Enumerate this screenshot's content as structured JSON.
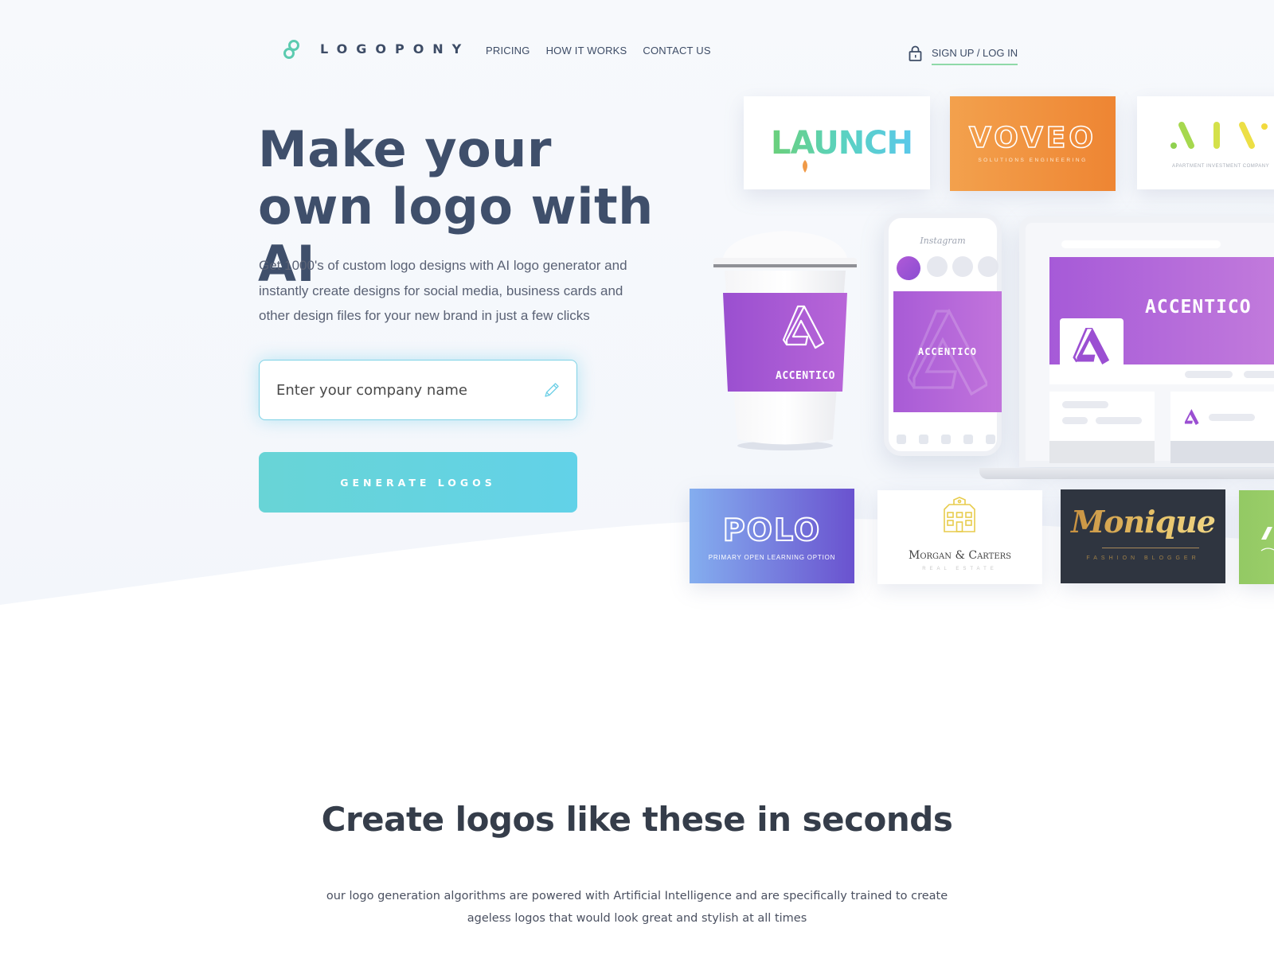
{
  "brand": {
    "name": "LOGOPONY",
    "accent_color": "#5ccbb0"
  },
  "nav": {
    "links": [
      {
        "label": "PRICING"
      },
      {
        "label": "HOW IT WORKS"
      },
      {
        "label": "CONTACT US"
      }
    ],
    "auth_label": "SIGN UP / LOG IN"
  },
  "hero": {
    "title": "Make your own logo with AI",
    "description": "Get 1000's of custom logo designs with AI logo generator and instantly create designs for social media, business cards and other design files for your new brand in just a few clicks",
    "company_input": {
      "placeholder": "Enter your company name",
      "value": ""
    },
    "generate_button": "GENERATE LOGOS",
    "button_color": "#64d3e0"
  },
  "showcase": {
    "logos": [
      {
        "name": "LAUNCH",
        "tagline": ""
      },
      {
        "name": "VOVEO",
        "tagline": "SOLUTIONS ENGINEERING"
      },
      {
        "name": "AIV",
        "tagline": "APARTMENT INVESTMENT COMPANY"
      },
      {
        "name": "POLO",
        "tagline": "PRIMARY OPEN LEARNING OPTION"
      },
      {
        "name": "Morgan & Carters",
        "tagline": "REAL ESTATE"
      },
      {
        "name": "Monique",
        "tagline": "FASHION BLOGGER"
      }
    ],
    "mockup_brand": "ACCENTICO",
    "phone_app": "Instagram"
  },
  "section2": {
    "title": "Create logos like these in seconds",
    "description": "our logo generation algorithms are powered with Artificial Intelligence and are specifically trained to create ageless logos that would look great and stylish at all times"
  }
}
